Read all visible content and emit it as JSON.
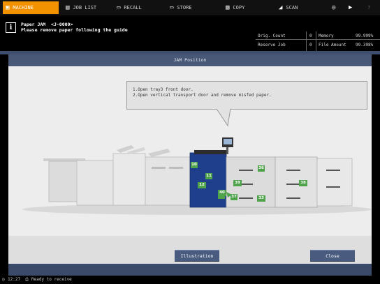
{
  "tabs": [
    {
      "label": "MACHINE",
      "icon": "machine-icon",
      "active": true
    },
    {
      "label": "JOB LIST",
      "icon": "job-list-icon"
    },
    {
      "label": "RECALL",
      "icon": "recall-icon"
    },
    {
      "label": "STORE",
      "icon": "store-icon"
    },
    {
      "label": "COPY",
      "icon": "copy-icon"
    },
    {
      "label": "SCAN",
      "icon": "scan-icon"
    },
    {
      "label": "",
      "icon": "globe-icon"
    },
    {
      "label": "",
      "icon": "speaker-icon"
    },
    {
      "label": "?",
      "icon": "help-icon"
    }
  ],
  "message": {
    "line1": "Paper JAM  <J-0000>",
    "line2": "Please remove paper following the guide"
  },
  "counters": {
    "orig_count_label": "Orig. Count",
    "orig_count_value": "0",
    "reserve_job_label": "Reserve Job",
    "reserve_job_value": "0",
    "memory_label": "Memory",
    "memory_value": "99.999%",
    "file_amount_label": "File Amount",
    "file_amount_value": "99.398%"
  },
  "panel_title": "JAM Position",
  "instructions": [
    "1.Open tray3 front door.",
    "2.Open vertical transport door and remove misfed paper."
  ],
  "jam_markers": [
    "10",
    "11",
    "12",
    "33",
    "36",
    "37",
    "38",
    "39",
    "40"
  ],
  "buttons": {
    "illustration": "Illustration",
    "close": "Close"
  },
  "status": {
    "time": "12:27",
    "text": "Ready to receive"
  },
  "colors": {
    "active_tab": "#f39200",
    "header_blue": "#4a5878",
    "jam_green": "#4fa34a",
    "machine_blue": "#1f3f8c"
  }
}
